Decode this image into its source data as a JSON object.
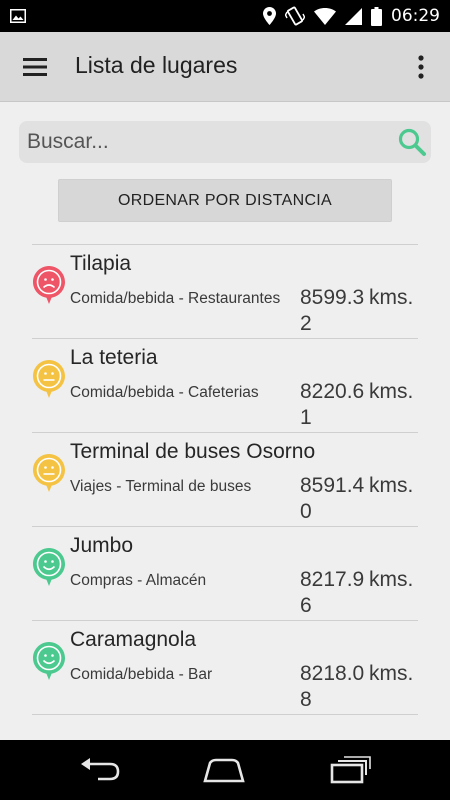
{
  "status_bar": {
    "time": "06:29",
    "icons": [
      "image-notification-icon",
      "location-icon",
      "vibrate-icon",
      "wifi-icon",
      "signal-icon",
      "battery-icon"
    ]
  },
  "app_bar": {
    "title": "Lista de lugares",
    "menu_icon": "hamburger-menu-icon",
    "overflow_icon": "more-vert-icon"
  },
  "search": {
    "placeholder": "Buscar...",
    "value": "",
    "icon": "search-icon",
    "accent_color": "#4cc98f"
  },
  "sort_button": {
    "label": "ORDENAR POR DISTANCIA"
  },
  "places": [
    {
      "name": "Tilapia",
      "category": "Comida/bebida - Restaurantes",
      "distance": "8599.32",
      "unit": "kms.",
      "pin_color": "#ee5567",
      "face": "sad"
    },
    {
      "name": "La teteria",
      "category": "Comida/bebida - Cafeterias",
      "distance": "8220.61",
      "unit": "kms.",
      "pin_color": "#f5c344",
      "face": "neutral"
    },
    {
      "name": "Terminal de buses Osorno",
      "category": "Viajes - Terminal de buses",
      "distance": "8591.40",
      "unit": "kms.",
      "pin_color": "#f5c344",
      "face": "neutral"
    },
    {
      "name": "Jumbo",
      "category": "Compras - Almacén",
      "distance": "8217.96",
      "unit": "kms.",
      "pin_color": "#4cc98f",
      "face": "happy"
    },
    {
      "name": "Caramagnola",
      "category": "Comida/bebida - Bar",
      "distance": "8218.08",
      "unit": "kms.",
      "pin_color": "#4cc98f",
      "face": "happy"
    }
  ],
  "nav_bar": {
    "buttons": [
      "back-icon",
      "home-icon",
      "recent-apps-icon"
    ]
  }
}
